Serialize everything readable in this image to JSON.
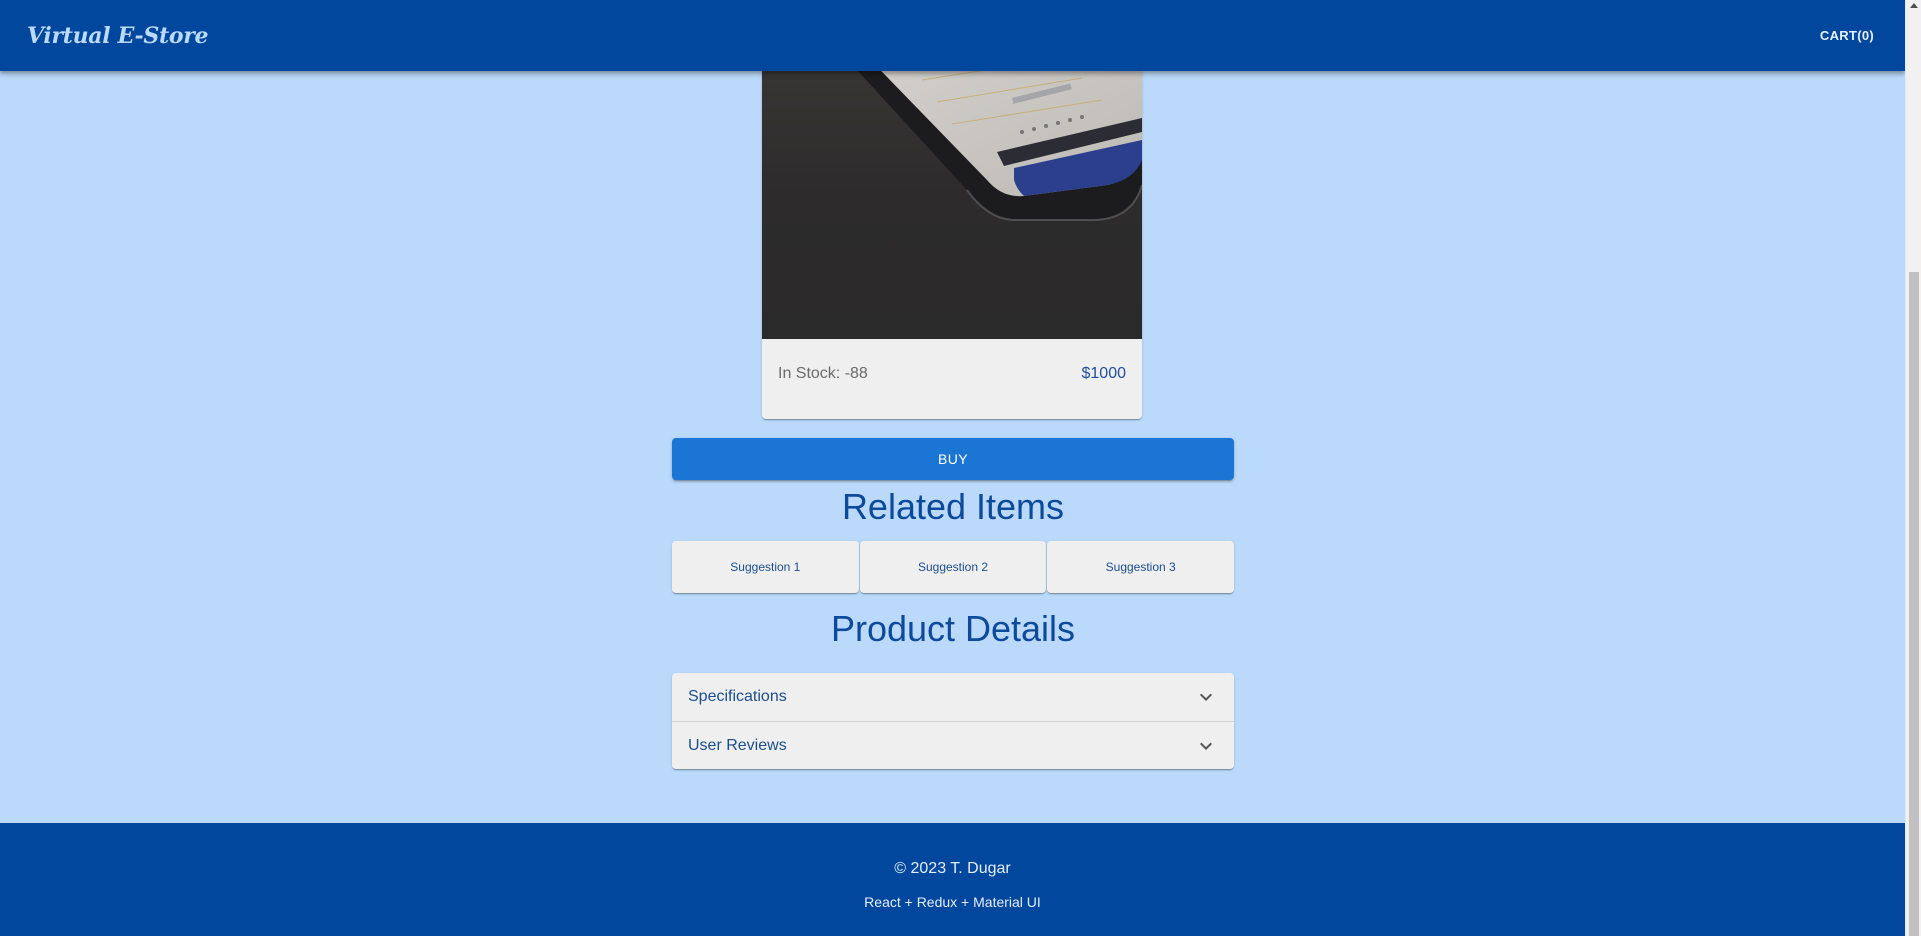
{
  "header": {
    "brand": "Virtual E-Store",
    "cart_label": "CART(0)"
  },
  "product": {
    "image_icon": "tablet-photo",
    "stock_label": "In Stock: -88",
    "price": "$1000",
    "buy_label": "BUY"
  },
  "related": {
    "title": "Related Items",
    "items": [
      {
        "label": "Suggestion 1"
      },
      {
        "label": "Suggestion 2"
      },
      {
        "label": "Suggestion 3"
      }
    ]
  },
  "details": {
    "title": "Product Details",
    "sections": [
      {
        "label": "Specifications",
        "icon": "chevron-down-icon"
      },
      {
        "label": "User Reviews",
        "icon": "chevron-down-icon"
      }
    ]
  },
  "footer": {
    "copyright": "© 2023 T. Dugar",
    "stack": "React + Redux + Material UI"
  },
  "colors": {
    "appbar": "#01479d",
    "background": "#bbdafb",
    "button": "#1b75d4",
    "heading": "#0e4a9c"
  }
}
